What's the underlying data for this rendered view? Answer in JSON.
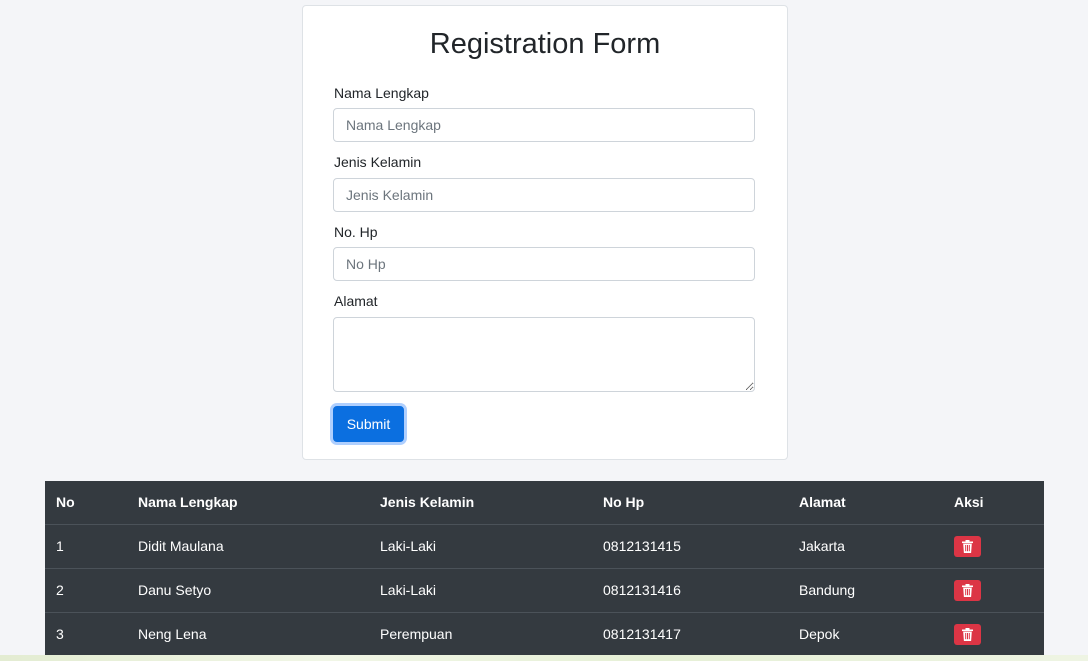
{
  "form": {
    "title": "Registration Form",
    "fields": [
      {
        "label": "Nama Lengkap",
        "placeholder": "Nama Lengkap",
        "value": ""
      },
      {
        "label": "Jenis Kelamin",
        "placeholder": "Jenis Kelamin",
        "value": ""
      },
      {
        "label": "No. Hp",
        "placeholder": "No Hp",
        "value": ""
      },
      {
        "label": "Alamat",
        "placeholder": "",
        "value": ""
      }
    ],
    "submit_label": "Submit",
    "colors": {
      "submit": "#0b6fe0"
    }
  },
  "table": {
    "headers": [
      "No",
      "Nama Lengkap",
      "Jenis Kelamin",
      "No Hp",
      "Alamat",
      "Aksi"
    ],
    "rows": [
      {
        "no": "1",
        "nama": "Didit Maulana",
        "jenis_kelamin": "Laki-Laki",
        "no_hp": "0812131415",
        "alamat": "Jakarta",
        "action_icon": "trash-icon"
      },
      {
        "no": "2",
        "nama": "Danu Setyo",
        "jenis_kelamin": "Laki-Laki",
        "no_hp": "0812131416",
        "alamat": "Bandung",
        "action_icon": "trash-icon"
      },
      {
        "no": "3",
        "nama": "Neng Lena",
        "jenis_kelamin": "Perempuan",
        "no_hp": "0812131417",
        "alamat": "Depok",
        "action_icon": "trash-icon"
      }
    ],
    "colors": {
      "background": "#343a40",
      "delete_button": "#dc3545"
    }
  }
}
